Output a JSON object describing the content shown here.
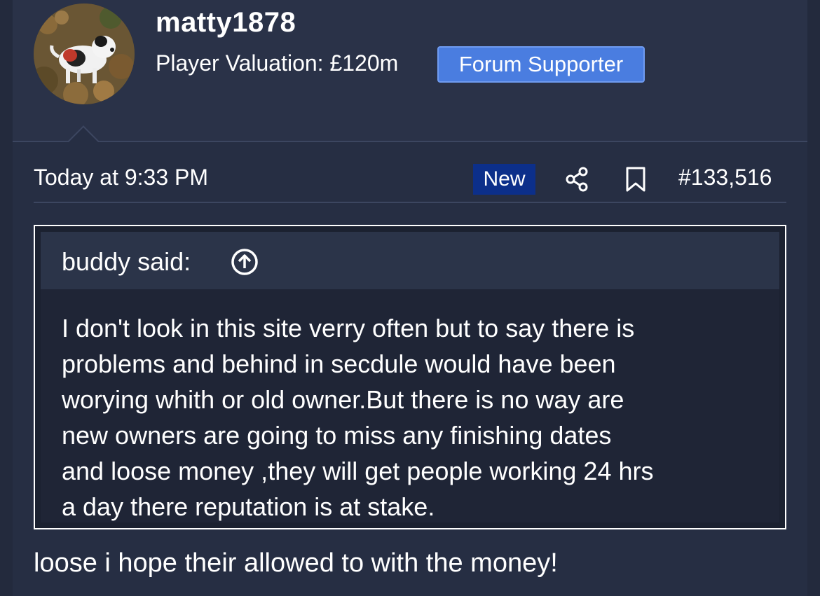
{
  "user": {
    "username": "matty1878",
    "valuation": "Player Valuation: £120m",
    "badge": "Forum Supporter",
    "avatar_icon": "avatar-dog-photo"
  },
  "post": {
    "time": "Today at 9:33 PM",
    "new_label": "New",
    "number": "#133,516",
    "share_icon": "share-icon",
    "bookmark_icon": "bookmark-icon"
  },
  "quote": {
    "author": "buddy said:",
    "arrow_icon": "arrow-up-circle-icon",
    "lines": [
      "I don't look in this site verry often but to say there is",
      "problems and behind in secdule would have been",
      "worying whith or old owner.But there is no way are",
      "new owners are going to miss any finishing dates",
      "and loose money ,they will get people working 24 hrs",
      "a day there reputation is at stake."
    ]
  },
  "reply": {
    "text": "loose i hope their allowed to with the money!"
  },
  "colors": {
    "background": "#262e43",
    "badge_blue": "#4a7de0",
    "new_badge": "#0c2f8a",
    "quote_header": "#2b3449"
  }
}
